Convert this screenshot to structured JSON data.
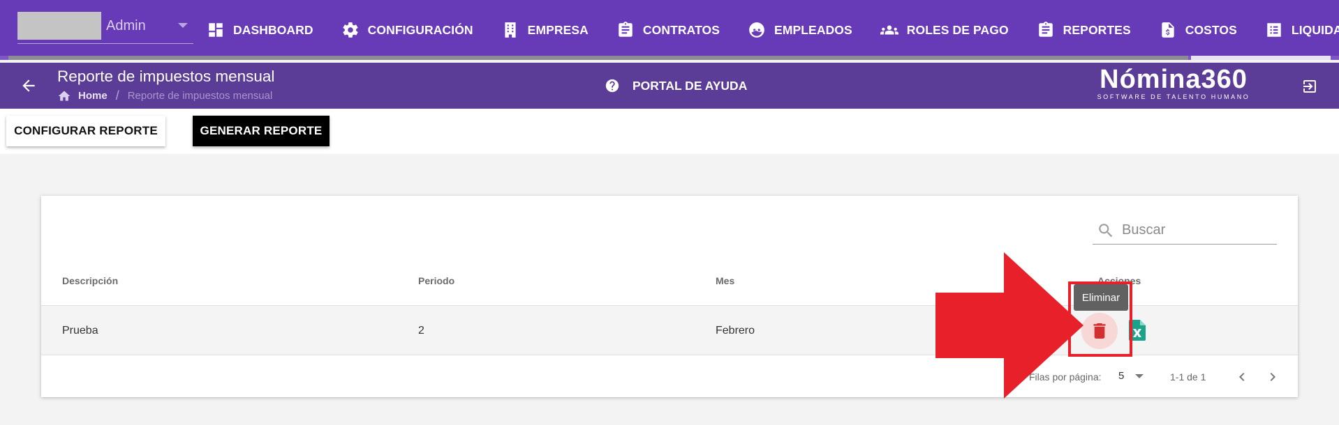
{
  "topnav": {
    "user_name": "Admin",
    "items": [
      {
        "label": "DASHBOARD",
        "icon": "dashboard-icon"
      },
      {
        "label": "CONFIGURACIÓN",
        "icon": "gear-icon"
      },
      {
        "label": "EMPRESA",
        "icon": "building-icon"
      },
      {
        "label": "CONTRATOS",
        "icon": "clipboard-icon"
      },
      {
        "label": "EMPLEADOS",
        "icon": "face-icon"
      },
      {
        "label": "ROLES DE PAGO",
        "icon": "group-icon"
      },
      {
        "label": "REPORTES",
        "icon": "clipboard-icon"
      },
      {
        "label": "COSTOS",
        "icon": "invoice-dollar-icon"
      },
      {
        "label": "LIQUIDACIONES",
        "icon": "list-icon"
      }
    ]
  },
  "subheader": {
    "title": "Reporte de impuestos mensual",
    "breadcrumb_home": "Home",
    "breadcrumb_sep": "/",
    "breadcrumb_current": "Reporte de impuestos mensual",
    "help_label": "PORTAL DE AYUDA",
    "logo_main": "Nómina360",
    "logo_sub": "SOFTWARE DE TALENTO HUMANO"
  },
  "toolbar": {
    "config_label": "CONFIGURAR REPORTE",
    "generate_label": "GENERAR REPORTE"
  },
  "table": {
    "search_placeholder": "Buscar",
    "headers": {
      "descripcion": "Descripción",
      "periodo": "Periodo",
      "mes": "Mes",
      "acciones": "Acciones"
    },
    "rows": [
      {
        "descripcion": "Prueba",
        "periodo": "2",
        "mes": "Febrero"
      }
    ],
    "tooltip": "Eliminar",
    "rows_per_page_label": "Filas por página:",
    "rows_per_page_value": "5",
    "range_label": "1-1 de 1"
  },
  "colors": {
    "nav_bg": "#673ab7",
    "subheader_bg": "#5b3c97",
    "delete_red": "#d32f2f",
    "excel_green": "#1aa38a",
    "annotation_red": "#e8202a"
  }
}
